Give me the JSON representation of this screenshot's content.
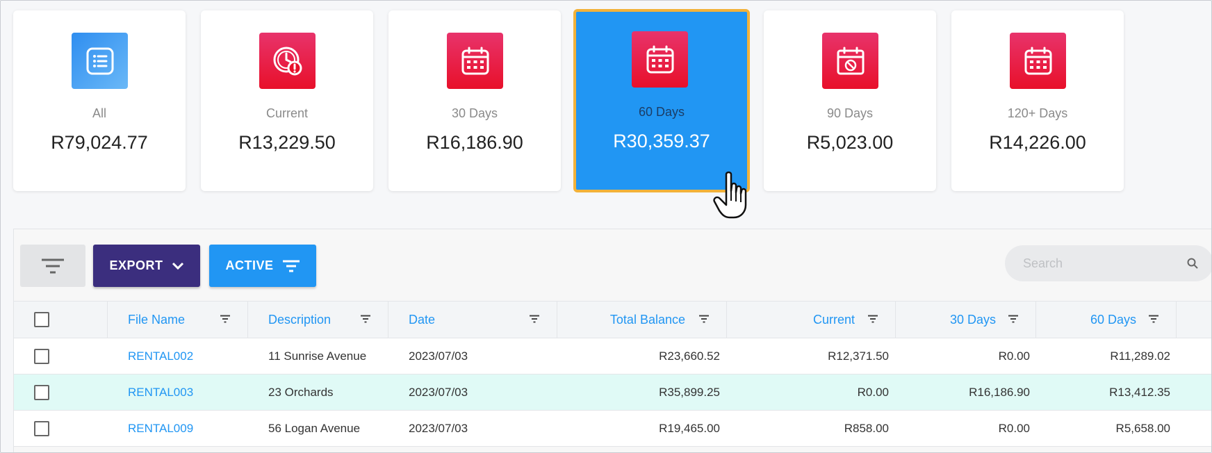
{
  "cards": [
    {
      "label": "All",
      "amount": "R79,024.77",
      "icon": "list-icon"
    },
    {
      "label": "Current",
      "amount": "R13,229.50",
      "icon": "clock-alert-icon"
    },
    {
      "label": "30 Days",
      "amount": "R16,186.90",
      "icon": "calendar-icon"
    },
    {
      "label": "60 Days",
      "amount": "R30,359.37",
      "icon": "calendar-icon",
      "selected": true
    },
    {
      "label": "90 Days",
      "amount": "R5,023.00",
      "icon": "calendar-blocked-icon"
    },
    {
      "label": "120+ Days",
      "amount": "R14,226.00",
      "icon": "calendar-icon"
    }
  ],
  "toolbar": {
    "export_label": "EXPORT",
    "active_label": "ACTIVE",
    "search_placeholder": "Search"
  },
  "table": {
    "columns": [
      "File Name",
      "Description",
      "Date",
      "Total Balance",
      "Current",
      "30 Days",
      "60 Days"
    ],
    "rows": [
      {
        "file": "RENTAL002",
        "description": "11 Sunrise Avenue",
        "date": "2023/07/03",
        "total": "R23,660.52",
        "current": "R12,371.50",
        "d30": "R0.00",
        "d60": "R11,289.02"
      },
      {
        "file": "RENTAL003",
        "description": "23 Orchards",
        "date": "2023/07/03",
        "total": "R35,899.25",
        "current": "R0.00",
        "d30": "R16,186.90",
        "d60": "R13,412.35"
      },
      {
        "file": "RENTAL009",
        "description": "56 Logan Avenue",
        "date": "2023/07/03",
        "total": "R19,465.00",
        "current": "R858.00",
        "d30": "R0.00",
        "d60": "R5,658.00"
      }
    ]
  },
  "colors": {
    "accent": "#2196f3",
    "icon_red": "#e8102a",
    "export_bg": "#3b2e7e",
    "selected_border": "#f2b23a",
    "row_highlight": "#e0faf6"
  }
}
